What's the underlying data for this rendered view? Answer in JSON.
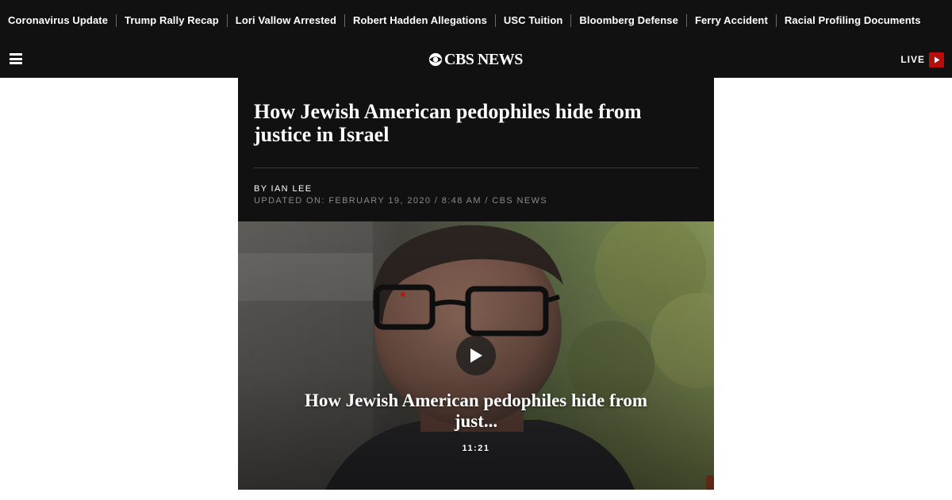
{
  "trending": {
    "items": [
      "Coronavirus Update",
      "Trump Rally Recap",
      "Lori Vallow Arrested",
      "Robert Hadden Allegations",
      "USC Tuition",
      "Bloomberg Defense",
      "Ferry Accident",
      "Racial Profiling Documents"
    ]
  },
  "header": {
    "logo_text": "CBS NEWS",
    "live_label": "LIVE",
    "menu_icon": "hamburger-icon",
    "live_icon": "play-icon"
  },
  "article": {
    "headline": "How Jewish American pedophiles hide from justice in Israel",
    "byline_prefix": "BY",
    "author": "IAN LEE",
    "updated": "UPDATED ON: FEBRUARY 19, 2020 / 8:48 AM / CBS NEWS"
  },
  "video": {
    "title": "How Jewish American pedophiles hide from just...",
    "duration": "11:21",
    "play_icon": "play-icon"
  },
  "colors": {
    "nav_bg": "#111111",
    "live_red": "#b80d0d",
    "muted_text": "#8a8a8a"
  }
}
